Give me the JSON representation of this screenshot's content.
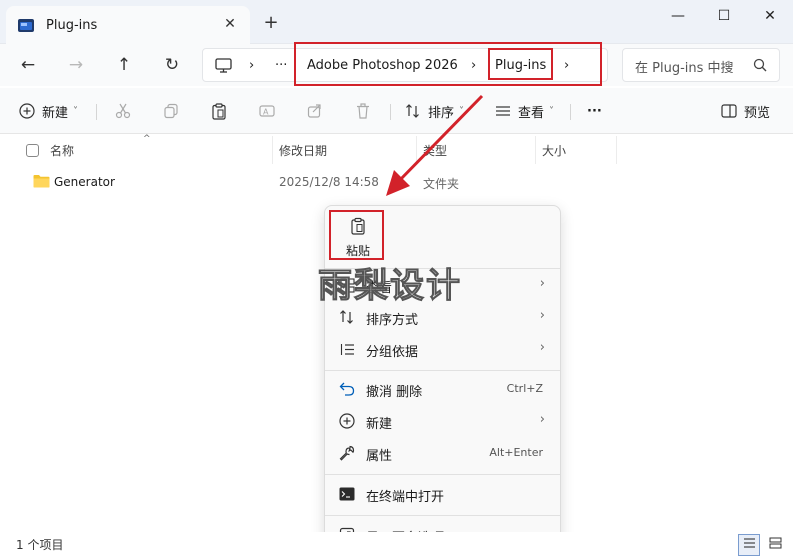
{
  "window": {
    "tab_title": "Plug-ins",
    "tab_close": "✕",
    "new_tab": "+",
    "minimize": "—",
    "maximize": "☐",
    "close": "✕"
  },
  "nav": {
    "back": "←",
    "forward": "→",
    "up": "↑",
    "refresh": "↻",
    "more": "···",
    "breadcrumb": [
      "Adobe Photoshop 2026",
      "Plug-ins"
    ],
    "separator": "›",
    "search_placeholder": "在 Plug-ins 中搜"
  },
  "toolbar": {
    "new_label": "新建",
    "sort_label": "排序",
    "view_label": "查看",
    "more_label": "···",
    "preview_label": "预览",
    "dropdown": "˅"
  },
  "columns": {
    "name": "名称",
    "date": "修改日期",
    "type": "类型",
    "size": "大小",
    "sort_chevron": "^"
  },
  "files": [
    {
      "name": "Generator",
      "date": "2025/12/8 14:58",
      "type": "文件夹",
      "size": ""
    }
  ],
  "context_menu": {
    "paste_label": "粘贴",
    "items": [
      {
        "label": "查看",
        "shortcut": "",
        "arrow": "›"
      },
      {
        "label": "排序方式",
        "shortcut": "",
        "arrow": "›"
      },
      {
        "label": "分组依据",
        "shortcut": "",
        "arrow": "›"
      },
      {
        "label": "撤消 删除",
        "shortcut": "Ctrl+Z",
        "arrow": ""
      },
      {
        "label": "新建",
        "shortcut": "",
        "arrow": "›"
      },
      {
        "label": "属性",
        "shortcut": "Alt+Enter",
        "arrow": ""
      },
      {
        "label": "在终端中打开",
        "shortcut": "",
        "arrow": ""
      },
      {
        "label": "显示更多选项",
        "shortcut": "",
        "arrow": ""
      }
    ]
  },
  "watermark": "雨梨设计",
  "status": {
    "item_count": "1 个项目"
  },
  "colors": {
    "highlight": "#d2222a",
    "folder": "#f4c430",
    "accent": "#005fb8"
  }
}
